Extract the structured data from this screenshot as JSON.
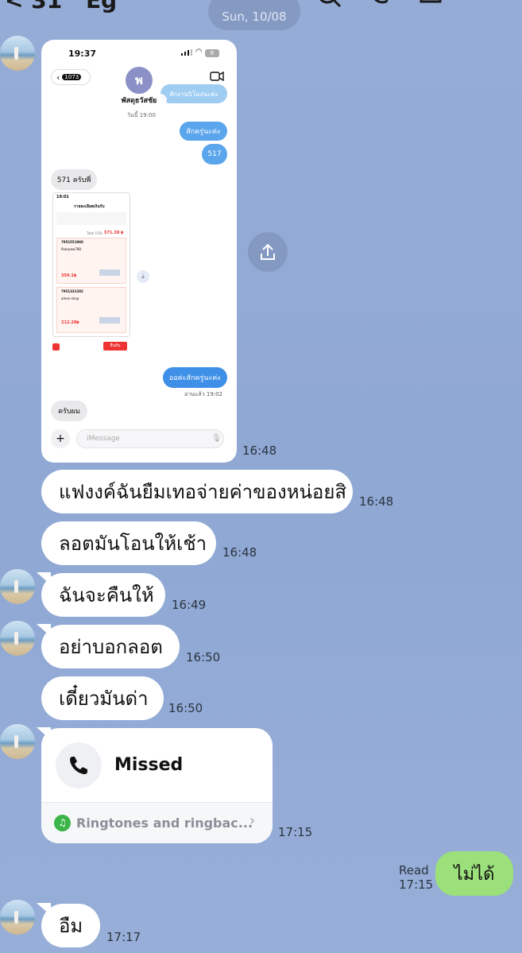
{
  "header": {
    "back_label": "31",
    "name": "Eg",
    "date_pill": "Sun, 10/08"
  },
  "screenshot_msg": {
    "status_time": "19:37",
    "battery": "8",
    "back_count": "1073",
    "avatar_letter": "พ",
    "contact_name": "พัสดุธวัสชัย",
    "bubble_top_partial": "ลักงาน5โมงนะค่ะ",
    "today_label": "วันนี้ 19:00",
    "msg_1": "สักครู่นะค่ะ",
    "msg_2": "517",
    "msg_3": "571 ครับพี่",
    "inner_status_time": "19:01",
    "inner_title": "รายละเอียดเงินรับ",
    "inner_total_label": "Total COD",
    "inner_total_value": "571.38 ฿",
    "inner_row1": "7951551960",
    "inner_row1_shop": "floorpaw788",
    "inner_row1_price": "359.1฿",
    "inner_row2": "7951331282",
    "inner_row2_shop": "amon-shop",
    "inner_row2_price": "212.28฿",
    "inner_button": "ยืนยัน",
    "msg_4": "ออค่ะสักครู่นะค่ะ",
    "msg_4_meta": "อ่านแล้ว 19:02",
    "msg_5": "ครับผม",
    "input_placeholder": "iMessage",
    "time": "16:48"
  },
  "messages": [
    {
      "text": "แฟงงค์ฉันยืมเทอจ่ายค่าของหน่อยสิ",
      "time": "16:48"
    },
    {
      "text": "ลอตมันโอนให้เช้า",
      "time": "16:48"
    },
    {
      "text": "ฉันจะคืนให้",
      "time": "16:49"
    },
    {
      "text": "อย่าบอกลอต",
      "time": "16:50"
    },
    {
      "text": "เดี๋ยวมันด่า",
      "time": "16:50"
    }
  ],
  "call": {
    "status": "Missed",
    "ringtone_label": "Ringtones and ringbac...",
    "time": "17:15"
  },
  "sent": {
    "text": "ไม่ได้",
    "read_label": "Read",
    "time": "17:15"
  },
  "last": {
    "text": "อืม",
    "time": "17:17"
  },
  "colors": {
    "background": "#8fa8d4",
    "sent_bubble": "#9ce07c",
    "received_bubble": "#ffffff"
  }
}
